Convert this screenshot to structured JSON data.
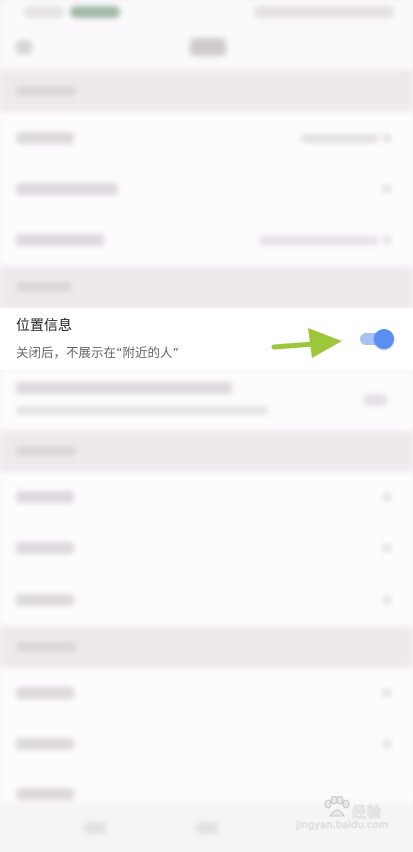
{
  "location_setting": {
    "title": "位置信息",
    "subtitle": "关闭后，不展示在“附近的人”",
    "enabled": true,
    "toggle_color": "#5b8ef2",
    "track_color": "#a8c2f5"
  },
  "annotation": {
    "arrow_color": "#9cc73a",
    "arrow_direction": "right"
  },
  "watermark": {
    "brand": "经验",
    "url": "jingyan.baidu.com",
    "icon": "baidu-paw-icon"
  }
}
